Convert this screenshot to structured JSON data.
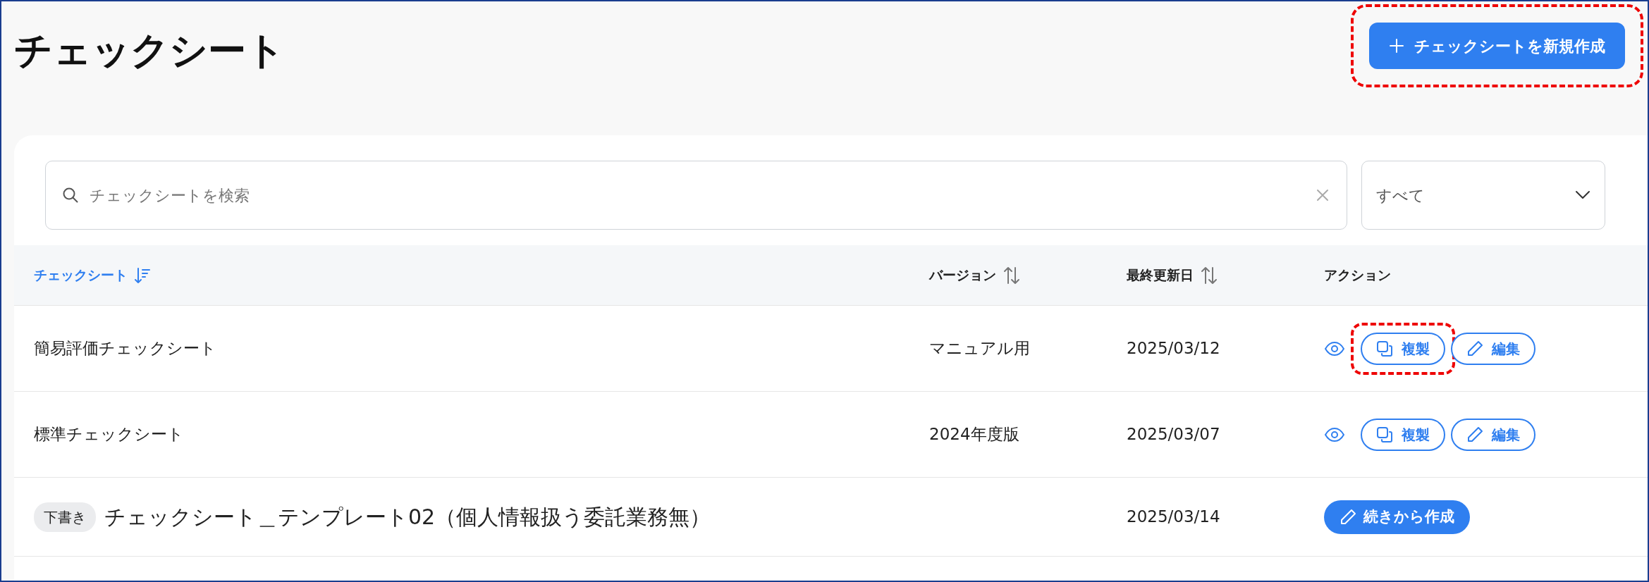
{
  "page": {
    "title": "チェックシート"
  },
  "create_button": {
    "label": "チェックシートを新規作成",
    "highlighted": true
  },
  "search": {
    "placeholder": "チェックシートを検索"
  },
  "filter": {
    "value": "すべて"
  },
  "table": {
    "columns": [
      {
        "label": "チェックシート",
        "sortable": true,
        "sorted": true
      },
      {
        "label": "バージョン",
        "sortable": true,
        "sorted": false
      },
      {
        "label": "最終更新日",
        "sortable": true,
        "sorted": false
      },
      {
        "label": "アクション",
        "sortable": false,
        "sorted": false
      }
    ],
    "rows": [
      {
        "kind": "sheet",
        "name": "簡易評価チェックシート",
        "version": "マニュアル用",
        "updated": "2025/03/12",
        "actions": [
          {
            "kind": "view",
            "highlighted": false
          },
          {
            "kind": "duplicate",
            "label": "複製",
            "highlighted": true
          },
          {
            "kind": "edit",
            "label": "編集",
            "highlighted": false
          }
        ]
      },
      {
        "kind": "sheet",
        "name": "標準チェックシート",
        "version": "2024年度版",
        "updated": "2025/03/07",
        "actions": [
          {
            "kind": "view",
            "highlighted": false
          },
          {
            "kind": "duplicate",
            "label": "複製",
            "highlighted": false
          },
          {
            "kind": "edit",
            "label": "編集",
            "highlighted": false
          }
        ]
      },
      {
        "kind": "draft",
        "badge": "下書き",
        "name": "チェックシート＿テンプレート02（個人情報扱う委託業務無）",
        "updated": "2025/03/14",
        "actions": [
          {
            "kind": "continue",
            "label": "続きから作成",
            "highlighted": false
          }
        ]
      }
    ]
  }
}
